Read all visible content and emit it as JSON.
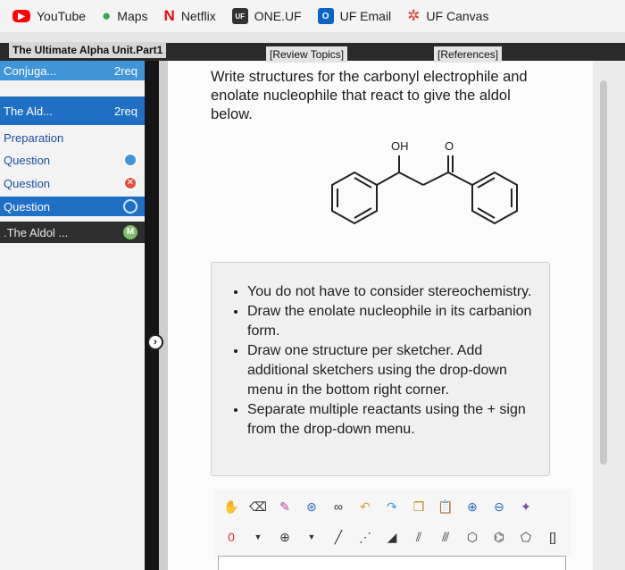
{
  "bookmarks": [
    {
      "label": "YouTube",
      "icon": "youtube-icon",
      "color": "#ff0000"
    },
    {
      "label": "Maps",
      "icon": "maps-pin-icon",
      "color": "#34a853"
    },
    {
      "label": "Netflix",
      "icon": "netflix-icon",
      "color": "#e50914"
    },
    {
      "label": "ONE.UF",
      "icon": "one-uf-icon",
      "color": "#333333"
    },
    {
      "label": "UF Email",
      "icon": "outlook-icon",
      "color": "#0a64c8"
    },
    {
      "label": "UF Canvas",
      "icon": "canvas-icon",
      "color": "#e03a28"
    }
  ],
  "assignment": {
    "title": "The Ultimate Alpha Unit.Part1"
  },
  "header_links": {
    "review": "[Review Topics]",
    "references": "[References]"
  },
  "nav": [
    {
      "label": "Conjuga...",
      "req": "2req"
    },
    {
      "label": "The Ald...",
      "req": "2req"
    },
    {
      "label": "Preparation"
    },
    {
      "label": "Question"
    },
    {
      "label": "Question"
    },
    {
      "label": "Question"
    },
    {
      "label": ".The Aldol ...",
      "badge": "M"
    }
  ],
  "question": {
    "text": "Write structures for the carbonyl electrophile and enolate nucleophile that react to give the aldol below.",
    "molecule_labels": {
      "oh": "OH",
      "o": "O"
    }
  },
  "notes": [
    "You do not have to consider stereochemistry.",
    "Draw the enolate nucleophile in its carbanion form.",
    "Draw one structure per sketcher. Add additional sketchers using the drop-down menu in the bottom right corner.",
    "Separate multiple reactants using the + sign from the drop-down menu."
  ],
  "toolbar": {
    "row1_icons": [
      "hand-icon",
      "eraser-icon",
      "pencil-icon",
      "ring-template-icon",
      "group-icon",
      "undo-icon",
      "redo-icon",
      "copy-icon",
      "paste-icon",
      "zoom-in-icon",
      "zoom-out-icon",
      "clean-icon"
    ],
    "charge_label": "0",
    "plus_label": "⊕"
  },
  "colors": {
    "accent": "#1f6fc4",
    "active_row": "#3f95d8",
    "dark": "#1a1a1a"
  }
}
